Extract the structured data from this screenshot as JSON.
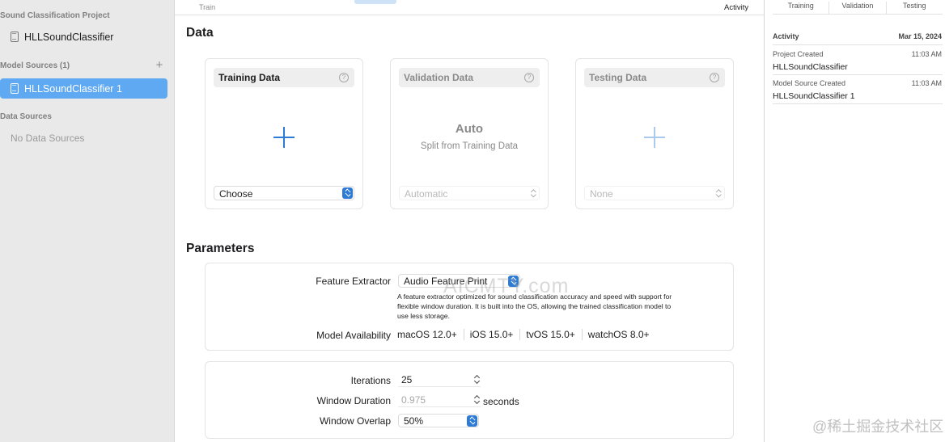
{
  "sidebar": {
    "project_section": "Sound Classification Project",
    "project_name": "HLLSoundClassifier",
    "model_sources_section": "Model Sources (1)",
    "model_source_item": "HLLSoundClassifier 1",
    "data_sources_section": "Data Sources",
    "data_sources_empty": "No Data Sources",
    "selected_color": "#5fa9f2"
  },
  "top": {
    "train_label": "Train",
    "activity_label": "Activity"
  },
  "data": {
    "title": "Data",
    "training": {
      "label": "Training Data",
      "choose": "Choose"
    },
    "validation": {
      "label": "Validation Data",
      "auto_title": "Auto",
      "auto_sub": "Split from Training Data",
      "select": "Automatic"
    },
    "testing": {
      "label": "Testing Data",
      "select": "None"
    }
  },
  "parameters": {
    "title": "Parameters",
    "feature_extractor_label": "Feature Extractor",
    "feature_extractor_value": "Audio Feature Print",
    "feature_extractor_desc": "A feature extractor optimized for sound classification accuracy and speed with support for flexible window duration. It is built into the OS, allowing the trained classification model to use less storage.",
    "model_availability_label": "Model Availability",
    "availability": [
      "macOS 12.0+",
      "iOS 15.0+",
      "tvOS 15.0+",
      "watchOS 8.0+"
    ],
    "iterations_label": "Iterations",
    "iterations_value": "25",
    "window_duration_label": "Window Duration",
    "window_duration_placeholder": "0.975",
    "window_duration_unit": "seconds",
    "window_overlap_label": "Window Overlap",
    "window_overlap_value": "50%"
  },
  "activity": {
    "tabs": [
      "Training",
      "Validation",
      "Testing"
    ],
    "header": "Activity",
    "date": "Mar 15, 2024",
    "entries": [
      {
        "kind": "Project Created",
        "time": "11:03 AM",
        "name": "HLLSoundClassifier"
      },
      {
        "kind": "Model Source Created",
        "time": "11:03 AM",
        "name": "HLLSoundClassifier 1"
      }
    ]
  },
  "colors": {
    "accent": "#2e7bd6"
  },
  "watermarks": {
    "center": "AICMTY.com",
    "corner": "@稀土掘金技术社区"
  }
}
